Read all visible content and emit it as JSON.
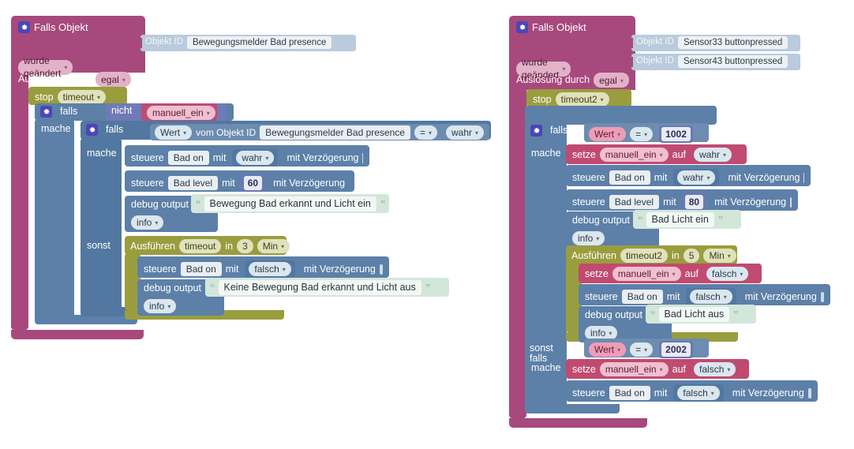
{
  "app": {
    "type": "blockly-visual-script-editor",
    "background": "#ffffff",
    "grid": "dotted"
  },
  "colors": {
    "event_block": "#a7497d",
    "control_block": "#5c80a8",
    "timeout_block": "#9a9d3e",
    "variable_block": "#c14a71",
    "object_id_plate": "#b9cbdd",
    "text_block": "#d3e6da",
    "number_socket": "#6d77b4"
  },
  "scripts": [
    {
      "id": "script-left",
      "event": {
        "icon": "gear-icon",
        "title": "Falls Objekt",
        "object_id_label": "Objekt ID",
        "object_ids": [
          "Bewegungsmelder Bad presence"
        ],
        "trigger_mode": "wurde geändert",
        "trigger_by_label": "Auslösung durch",
        "trigger_by_value": "egal"
      },
      "body": [
        {
          "kind": "stop_timeout",
          "label": "stop",
          "timer": "timeout"
        },
        {
          "kind": "if",
          "icon": "gear-icon",
          "if_label": "falls",
          "condition": {
            "op": "nicht",
            "operand": "manuell_ein"
          },
          "do_label": "mache",
          "do": [
            {
              "kind": "if",
              "icon": "gear-icon",
              "if_label": "falls",
              "condition": {
                "getter": "Wert",
                "from_label": "vom Objekt ID",
                "object_id": "Bewegungsmelder Bad presence",
                "operator": "=",
                "value": "wahr"
              },
              "do_label": "mache",
              "do": [
                {
                  "kind": "control",
                  "verb": "steuere",
                  "target": "Bad on",
                  "with_label": "mit",
                  "value": "wahr",
                  "value_type": "bool",
                  "delay_label": "mit Verzögerung",
                  "delay_checked": false
                },
                {
                  "kind": "control",
                  "verb": "steuere",
                  "target": "Bad level",
                  "with_label": "mit",
                  "value": "60",
                  "value_type": "number",
                  "delay_label": "mit Verzögerung",
                  "delay_checked": false
                },
                {
                  "kind": "debug",
                  "label": "debug output",
                  "text": "Bewegung Bad erkannt und Licht ein",
                  "level": "info"
                }
              ],
              "else_label": "sonst",
              "else": [
                {
                  "kind": "timeout",
                  "label": "Ausführen",
                  "timer": "timeout",
                  "in_label": "in",
                  "amount": "3",
                  "unit": "Min",
                  "body": [
                    {
                      "kind": "control",
                      "verb": "steuere",
                      "target": "Bad on",
                      "with_label": "mit",
                      "value": "falsch",
                      "value_type": "bool",
                      "delay_label": "mit Verzögerung",
                      "delay_checked": false
                    },
                    {
                      "kind": "debug",
                      "label": "debug output",
                      "text": "Keine Bewegung Bad erkannt und Licht aus",
                      "level": "info"
                    }
                  ]
                }
              ]
            }
          ]
        }
      ]
    },
    {
      "id": "script-right",
      "event": {
        "icon": "gear-icon",
        "title": "Falls Objekt",
        "object_id_label": "Objekt ID",
        "object_ids": [
          "Sensor33 buttonpressed",
          "Sensor43 buttonpressed"
        ],
        "trigger_mode": "wurde geändert",
        "trigger_by_label": "Auslösung durch",
        "trigger_by_value": "egal"
      },
      "body": [
        {
          "kind": "stop_timeout",
          "label": "stop",
          "timer": "timeout2"
        },
        {
          "kind": "if",
          "icon": "gear-icon",
          "if_label": "falls",
          "condition": {
            "getter": "Wert",
            "operator": "=",
            "value": "1002"
          },
          "do_label": "mache",
          "do": [
            {
              "kind": "set",
              "label": "setze",
              "variable": "manuell_ein",
              "to_label": "auf",
              "value": "wahr"
            },
            {
              "kind": "control",
              "verb": "steuere",
              "target": "Bad on",
              "with_label": "mit",
              "value": "wahr",
              "value_type": "bool",
              "delay_label": "mit Verzögerung",
              "delay_checked": false
            },
            {
              "kind": "control",
              "verb": "steuere",
              "target": "Bad level",
              "with_label": "mit",
              "value": "80",
              "value_type": "number",
              "delay_label": "mit Verzögerung",
              "delay_checked": false
            },
            {
              "kind": "debug",
              "label": "debug output",
              "text": "Bad Licht ein",
              "level": "info"
            },
            {
              "kind": "timeout",
              "label": "Ausführen",
              "timer": "timeout2",
              "in_label": "in",
              "amount": "5",
              "unit": "Min",
              "body": [
                {
                  "kind": "set",
                  "label": "setze",
                  "variable": "manuell_ein",
                  "to_label": "auf",
                  "value": "falsch"
                },
                {
                  "kind": "control",
                  "verb": "steuere",
                  "target": "Bad on",
                  "with_label": "mit",
                  "value": "falsch",
                  "value_type": "bool",
                  "delay_label": "mit Verzögerung",
                  "delay_checked": false
                },
                {
                  "kind": "debug",
                  "label": "debug output",
                  "text": "Bad Licht aus",
                  "level": "info"
                }
              ]
            }
          ],
          "elseif_label": "sonst falls",
          "elseif_condition": {
            "getter": "Wert",
            "operator": "=",
            "value": "2002"
          },
          "elseif_do_label": "mache",
          "elseif_do": [
            {
              "kind": "set",
              "label": "setze",
              "variable": "manuell_ein",
              "to_label": "auf",
              "value": "falsch"
            },
            {
              "kind": "control",
              "verb": "steuere",
              "target": "Bad on",
              "with_label": "mit",
              "value": "falsch",
              "value_type": "bool",
              "delay_label": "mit Verzögerung",
              "delay_checked": false
            }
          ]
        }
      ]
    }
  ]
}
